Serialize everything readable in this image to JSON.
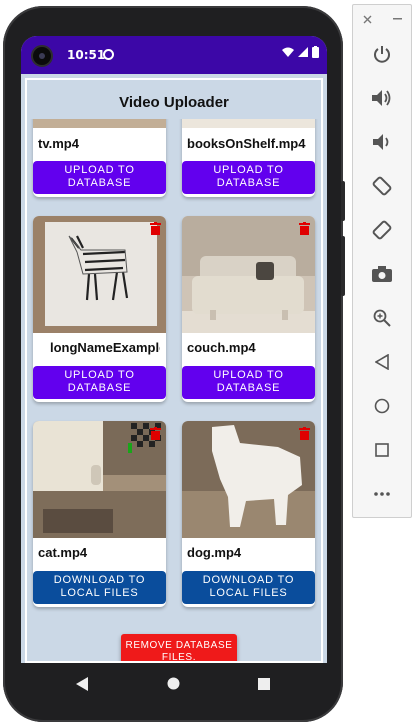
{
  "status": {
    "time": "10:51"
  },
  "app": {
    "title": "Video Uploader",
    "cards": [
      {
        "filename": "tv.mp4",
        "button": "UPLOAD TO DATABASE"
      },
      {
        "filename": "booksOnShelf.mp4",
        "button": "UPLOAD TO DATABASE"
      },
      {
        "filename": "longNameExample",
        "button": "UPLOAD TO DATABASE"
      },
      {
        "filename": "couch.mp4",
        "button": "UPLOAD TO DATABASE"
      },
      {
        "filename": "cat.mp4",
        "button": "DOWNLOAD TO LOCAL FILES"
      },
      {
        "filename": "dog.mp4",
        "button": "DOWNLOAD TO LOCAL FILES"
      }
    ],
    "fab_label": "REMOVE DATABASE FILES."
  },
  "toolbar": {
    "items": [
      "close-icon",
      "minimize-icon",
      "power-icon",
      "volume-up-icon",
      "volume-down-icon",
      "rotate-left-icon",
      "rotate-right-icon",
      "camera-icon",
      "zoom-icon",
      "back-icon",
      "home-icon",
      "overview-icon",
      "more-icon"
    ]
  },
  "colors": {
    "status_bar": "#3c07a7",
    "upload_button": "#6200ee",
    "download_button": "#0a4d9c",
    "fab": "#ef1a1a",
    "delete_icon": "#e00000"
  }
}
